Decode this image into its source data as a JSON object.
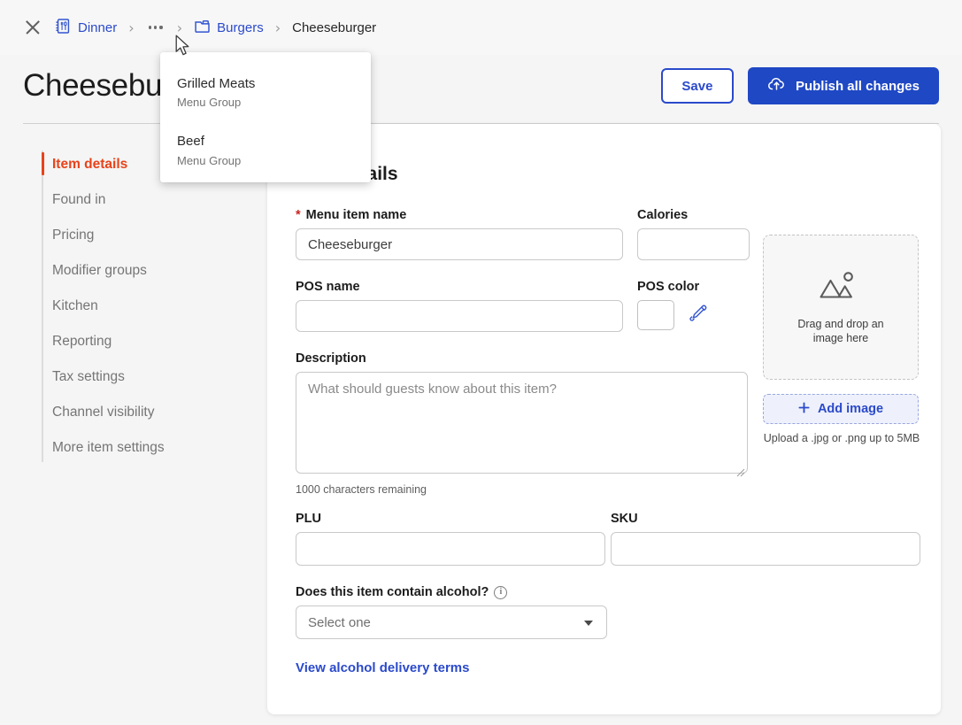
{
  "breadcrumb": {
    "close_label": "Close",
    "items": [
      {
        "label": "Dinner",
        "icon": "menu-book-icon",
        "type": "link"
      },
      {
        "label": "…",
        "icon": "ellipsis-icon",
        "type": "overflow"
      },
      {
        "label": "Burgers",
        "icon": "folder-icon",
        "type": "link"
      },
      {
        "label": "Cheeseburger",
        "icon": "",
        "type": "current"
      }
    ],
    "separator": "›"
  },
  "overflow_menu": {
    "items": [
      {
        "title": "Grilled Meats",
        "subtitle": "Menu Group"
      },
      {
        "title": "Beef",
        "subtitle": "Menu Group"
      }
    ]
  },
  "header": {
    "title": "Cheeseburger",
    "save_label": "Save",
    "publish_label": "Publish all changes",
    "publish_icon": "cloud-upload-icon"
  },
  "sidebar": {
    "items": [
      {
        "label": "Item details",
        "active": true
      },
      {
        "label": "Found in",
        "active": false
      },
      {
        "label": "Pricing",
        "active": false
      },
      {
        "label": "Modifier groups",
        "active": false
      },
      {
        "label": "Kitchen",
        "active": false
      },
      {
        "label": "Reporting",
        "active": false
      },
      {
        "label": "Tax settings",
        "active": false
      },
      {
        "label": "Channel visibility",
        "active": false
      },
      {
        "label": "More item settings",
        "active": false
      }
    ]
  },
  "main": {
    "card_title": "Item details",
    "fields": {
      "menu_item_name": {
        "label": "Menu item name",
        "required_marker": "*",
        "value": "Cheeseburger",
        "placeholder": ""
      },
      "calories": {
        "label": "Calories",
        "value": "",
        "placeholder": ""
      },
      "pos_name": {
        "label": "POS name",
        "value": "",
        "placeholder": ""
      },
      "pos_color": {
        "label": "POS color",
        "value": "#ffffff",
        "eyedropper_icon": "eyedropper-icon"
      },
      "description": {
        "label": "Description",
        "value": "",
        "placeholder": "What should guests know about this item?",
        "counter": "1000 characters remaining"
      },
      "plu": {
        "label": "PLU",
        "value": "",
        "placeholder": ""
      },
      "sku": {
        "label": "SKU",
        "value": "",
        "placeholder": ""
      },
      "alcohol": {
        "label": "Does this item contain alcohol?",
        "info_icon": "info-icon",
        "selected": "Select one",
        "options": [
          "Select one"
        ]
      },
      "alcohol_link": "View alcohol delivery terms"
    },
    "image_panel": {
      "dropzone_text": "Drag and drop an image here",
      "placeholder_icon": "image-placeholder-icon",
      "add_button_label": "Add image",
      "add_button_icon": "plus-icon",
      "upload_note": "Upload a .jpg or .png up to 5MB"
    }
  },
  "colors": {
    "accent_orange": "#e8431a",
    "link_blue": "#2b4acb",
    "primary_blue": "#1f48c4",
    "required_red": "#c9211e",
    "page_bg": "#f5f5f5"
  }
}
